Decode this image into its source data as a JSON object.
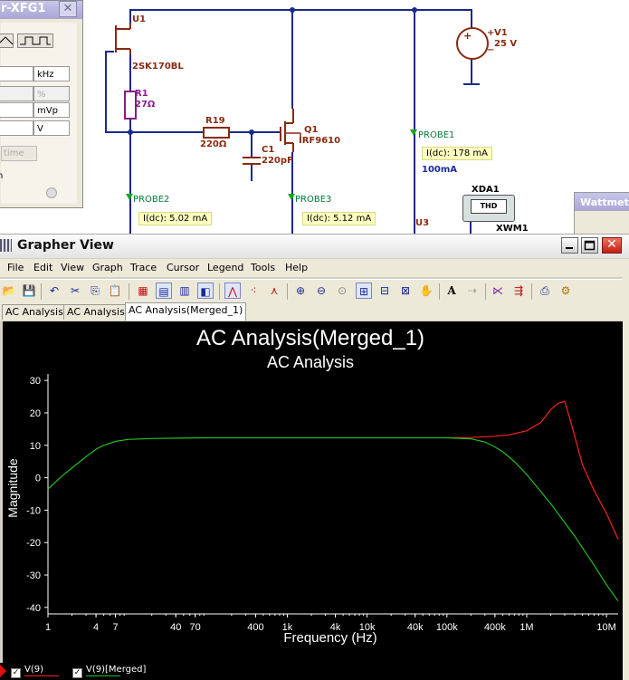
{
  "schematic": {
    "generator_window": {
      "title": "r-XFG1",
      "close_glyph": "✕",
      "units": [
        "kHz",
        "%",
        "mVp",
        "V"
      ],
      "time_button": "time",
      "fragment": "n"
    },
    "components": {
      "u1": "U1",
      "u1_part": "2SK170BL",
      "r1": "R1",
      "r1_value": "27Ω",
      "r19": "R19",
      "r19_value": "220Ω",
      "c1": "C1",
      "c1_value": "220pF",
      "q1": "Q1",
      "q1_part": "IRF9610",
      "v1": "V1",
      "v1_value": "25 V",
      "v1_plus": "+",
      "v1_minus": "−",
      "u3": "U3",
      "xda1": "XDA1",
      "xda1_screen": "THD",
      "xwm1": "XWM1"
    },
    "probes": [
      {
        "label": "PROBE1",
        "readout": "I(dc): 178 mA",
        "extra": "100mA"
      },
      {
        "label": "PROBE2",
        "readout": "I(dc): 5.02 mA"
      },
      {
        "label": "PROBE3",
        "readout": "I(dc): 5.12 mA"
      }
    ],
    "wattmeter_title": "Wattmeter"
  },
  "grapher": {
    "title": "Grapher View",
    "menus": [
      "File",
      "Edit",
      "View",
      "Graph",
      "Trace",
      "Cursor",
      "Legend",
      "Tools",
      "Help"
    ],
    "toolbar_icons": [
      "open-icon",
      "save-icon",
      "undo-icon",
      "cut-icon",
      "copy-icon",
      "paste-icon",
      "grid-icon",
      "legend-icon",
      "toggle-grid-icon",
      "reverse-colors-icon",
      "cursor-icon",
      "show-points-icon",
      "select-marks-icon",
      "zoom-in-icon",
      "zoom-out-icon",
      "zoom-full-icon",
      "zoom-area-icon",
      "zoom-x-icon",
      "zoom-y-icon",
      "pan-icon",
      "text-icon",
      "export-icon",
      "add-trace-icon",
      "merge-icon",
      "print-icon",
      "properties-icon"
    ],
    "toolbar_glyphs": [
      "📂",
      "💾",
      "↶",
      "✂",
      "⎘",
      "📋",
      "▦",
      "▤",
      "▥",
      "◧",
      "⋀",
      "⁖",
      "⋏",
      "⊕",
      "⊖",
      "⊙",
      "⊞",
      "⊟",
      "⊠",
      "✋",
      "A",
      "⇢",
      "⋉",
      "⇶",
      "⎙",
      "⚙"
    ],
    "tabs": [
      "AC Analysis",
      "AC Analysis",
      "AC Analysis(Merged_1)"
    ],
    "active_tab": 2,
    "window_buttons": {
      "minimize": "_",
      "maximize": "□",
      "close": "✕"
    }
  },
  "chart_data": {
    "type": "line",
    "title": "AC Analysis(Merged_1)",
    "subtitle": "AC Analysis",
    "xlabel": "Frequency (Hz)",
    "ylabel": "Magnitude",
    "xscale": "log",
    "xlim": [
      1,
      14000000
    ],
    "ylim": [
      -42,
      32
    ],
    "xticks": [
      1,
      4,
      7,
      40,
      70,
      400,
      1000,
      4000,
      10000,
      40000,
      100000,
      400000,
      1000000,
      10000000
    ],
    "xticklabels": [
      "1",
      "4",
      "7",
      "40",
      "70",
      "400",
      "1k",
      "4k",
      "10k",
      "40k",
      "100k",
      "400k",
      "1M",
      "10M"
    ],
    "yticks": [
      30,
      20,
      10,
      0,
      -10,
      -20,
      -30,
      -40
    ],
    "grid": false,
    "legend_position": "bottom-left",
    "background": "#000000",
    "axis_color": "#ffffff",
    "series": [
      {
        "name": "V(9)",
        "color": "#ff2020",
        "x": [
          100000,
          200000,
          400000,
          600000,
          1000000,
          1500000,
          2000000,
          2500000,
          3000000,
          3500000,
          5000000,
          7000000,
          10000000,
          14000000
        ],
        "y": [
          12.3,
          12.4,
          12.8,
          13.2,
          14.5,
          17.0,
          21.0,
          23.0,
          23.5,
          18.0,
          4.0,
          -4.0,
          -11.0,
          -19.0
        ]
      },
      {
        "name": "V(9)[Merged]",
        "color": "#20c020",
        "x": [
          1,
          1.5,
          2,
          3,
          4,
          5,
          7,
          10,
          20,
          40,
          100,
          1000,
          10000,
          100000,
          200000,
          300000,
          400000,
          500000,
          700000,
          1000000,
          2000000,
          4000000,
          7000000,
          10000000,
          14000000
        ],
        "y": [
          -3.5,
          0.5,
          3.0,
          6.5,
          8.8,
          10.0,
          11.2,
          11.8,
          12.1,
          12.2,
          12.3,
          12.3,
          12.3,
          12.3,
          12.0,
          11.0,
          9.5,
          8.0,
          5.0,
          1.0,
          -8.0,
          -18.0,
          -27.0,
          -33.0,
          -38.0
        ]
      }
    ]
  }
}
